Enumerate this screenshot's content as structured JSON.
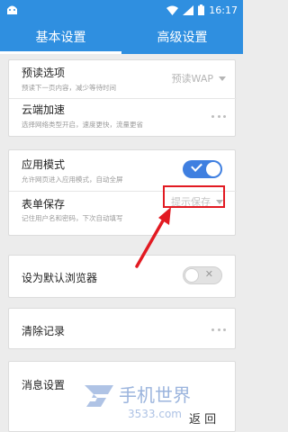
{
  "status_bar": {
    "time": "16:17"
  },
  "tabs": [
    {
      "label": "基本设置",
      "active": true
    },
    {
      "label": "高级设置",
      "active": false
    }
  ],
  "settings": {
    "preread": {
      "title": "预读选项",
      "subtitle": "预读下一页内容，减少等待时间",
      "value": "预读WAP"
    },
    "cloud": {
      "title": "云端加速",
      "subtitle": "选择网络类型开启，速度更快，流量更省"
    },
    "app_mode": {
      "title": "应用模式",
      "subtitle": "允许网页进入应用模式，自动全屏",
      "enabled": true
    },
    "form_save": {
      "title": "表单保存",
      "subtitle": "记住用户名和密码，下次自动填写",
      "value": "提示保存"
    },
    "default_browser": {
      "title": "设为默认浏览器",
      "enabled": false
    },
    "clear_records": {
      "title": "清除记录"
    },
    "message_settings": {
      "title": "消息设置"
    }
  },
  "watermark": {
    "brand": "手机世界",
    "url": "3533.com"
  },
  "bottom_bar": {
    "back_label": "返 回"
  },
  "colors": {
    "accent": "#2f8fe0",
    "toggle_on": "#3f7fe0",
    "highlight": "#e21a22"
  },
  "icons": [
    "android-icon",
    "wifi-icon",
    "signal-icon",
    "battery-icon",
    "more-dots-icon",
    "dropdown-caret-icon",
    "red-arrow-icon"
  ]
}
